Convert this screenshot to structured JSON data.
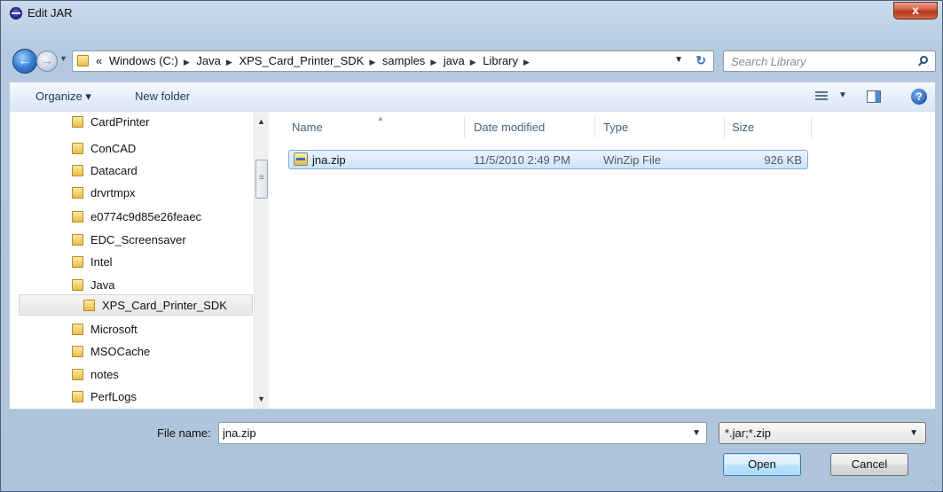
{
  "window": {
    "title": "Edit JAR",
    "close_label": "x"
  },
  "address": {
    "crumbs": [
      "Windows (C:)",
      "Java",
      "XPS_Card_Printer_SDK",
      "samples",
      "java",
      "Library"
    ],
    "overflow_marker": "«"
  },
  "search": {
    "placeholder": "Search Library"
  },
  "commands": {
    "organize_label": "Organize ▾",
    "new_folder_label": "New folder"
  },
  "nav_tree": {
    "items": [
      {
        "label": "CardPrinter"
      },
      {
        "label": "ConCAD"
      },
      {
        "label": "Datacard"
      },
      {
        "label": "drvrtmpx"
      },
      {
        "label": "e0774c9d85e26feaec"
      },
      {
        "label": "EDC_Screensaver"
      },
      {
        "label": "Intel"
      },
      {
        "label": "Java"
      },
      {
        "label": "XPS_Card_Printer_SDK",
        "selected": true
      },
      {
        "label": "Microsoft"
      },
      {
        "label": "MSOCache"
      },
      {
        "label": "notes"
      },
      {
        "label": "PerfLogs"
      }
    ]
  },
  "file_list": {
    "columns": [
      "Name",
      "Date modified",
      "Type",
      "Size"
    ],
    "rows": [
      {
        "name": "jna.zip",
        "date_modified": "11/5/2010 2:49 PM",
        "type": "WinZip File",
        "size": "926 KB",
        "selected": true
      }
    ]
  },
  "footer": {
    "file_name_label": "File name:",
    "file_name_value": "jna.zip",
    "filter_value": "*.jar;*.zip",
    "open_label": "Open",
    "cancel_label": "Cancel"
  },
  "colors": {
    "selection_fill": "#cbe4fc",
    "selection_border": "#84acdd",
    "accent": "#3c7fb1"
  }
}
